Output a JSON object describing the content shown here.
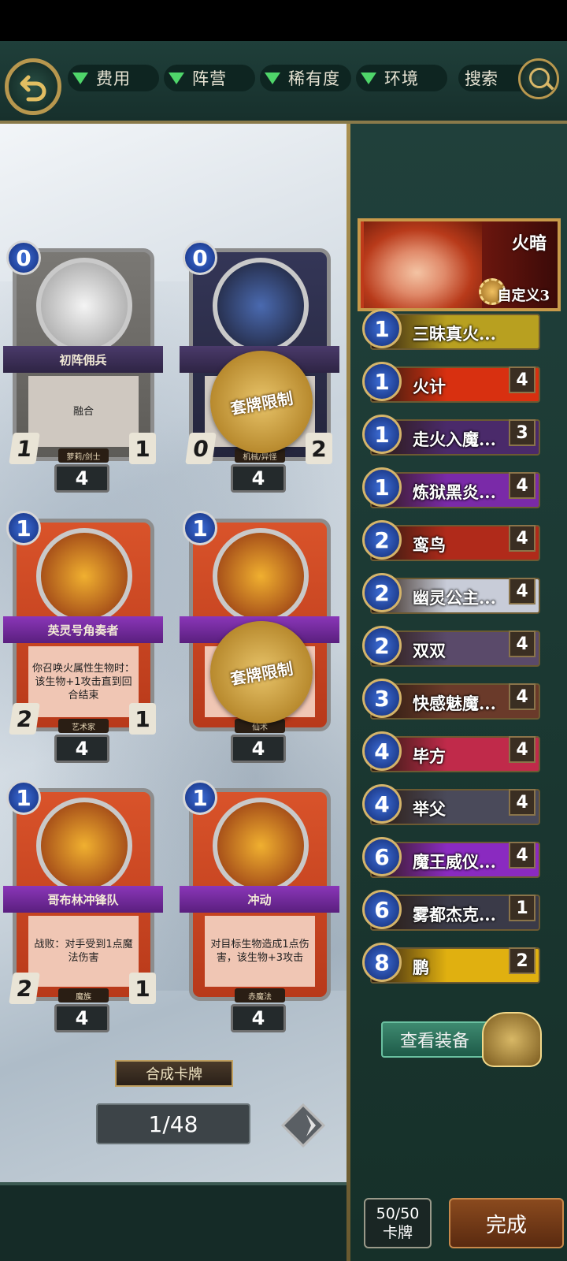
{
  "filters": {
    "cost": "费用",
    "faction": "阵营",
    "rarity": "稀有度",
    "environment": "环境",
    "search": "搜索"
  },
  "cards": [
    {
      "name": "初阵佣兵",
      "cost": "0",
      "atk": "1",
      "hp": "1",
      "desc": "融合",
      "tribe": "萝莉/剑士",
      "count": "4",
      "style": "neutral",
      "sealed": false
    },
    {
      "name": "",
      "cost": "0",
      "atk": "0",
      "hp": "2",
      "desc": "",
      "tribe": "机械/异怪",
      "count": "4",
      "style": "dark",
      "sealed": true
    },
    {
      "name": "英灵号角奏者",
      "cost": "1",
      "atk": "2",
      "hp": "1",
      "desc": "你召唤火属性生物时：该生物+1攻击直到回合结束",
      "tribe": "艺术家",
      "count": "4",
      "style": "fire",
      "sealed": false
    },
    {
      "name": "",
      "cost": "1",
      "atk": "",
      "hp": "",
      "desc": "",
      "tribe": "仙术",
      "count": "4",
      "style": "fire",
      "sealed": true
    },
    {
      "name": "哥布林冲锋队",
      "cost": "1",
      "atk": "2",
      "hp": "1",
      "desc": "战败：对手受到1点魔法伤害",
      "tribe": "魔族",
      "count": "4",
      "style": "fire",
      "sealed": false
    },
    {
      "name": "冲动",
      "cost": "1",
      "atk": "",
      "hp": "",
      "desc": "对目标生物造成1点伤害，该生物+3攻击",
      "tribe": "赤魔法",
      "count": "4",
      "style": "fire",
      "sealed": false
    }
  ],
  "seal_text": "套牌限制",
  "craft_label": "合成卡牌",
  "page_indicator": "1/48",
  "hero": {
    "name": "火暗",
    "deck_name": "自定义3"
  },
  "deck": [
    {
      "cost": "1",
      "name": "三昧真火...",
      "count": "",
      "color": "#b8a020"
    },
    {
      "cost": "1",
      "name": "火计",
      "count": "4",
      "color": "#d83010"
    },
    {
      "cost": "1",
      "name": "走火入魔...",
      "count": "3",
      "color": "#4a2a6a"
    },
    {
      "cost": "1",
      "name": "炼狱黑炎...",
      "count": "4",
      "color": "#7a2aa8"
    },
    {
      "cost": "2",
      "name": "鸾鸟",
      "count": "4",
      "color": "#b02a1a"
    },
    {
      "cost": "2",
      "name": "幽灵公主...",
      "count": "4",
      "color": "#c8ccd8"
    },
    {
      "cost": "2",
      "name": "双双",
      "count": "4",
      "color": "#5a4a6a"
    },
    {
      "cost": "3",
      "name": "快感魅魔...",
      "count": "4",
      "color": "#6a3a2a"
    },
    {
      "cost": "4",
      "name": "毕方",
      "count": "4",
      "color": "#c02a4a"
    },
    {
      "cost": "4",
      "name": "举父",
      "count": "4",
      "color": "#4a4a5a"
    },
    {
      "cost": "6",
      "name": "魔王威仪...",
      "count": "4",
      "color": "#8a2ac0"
    },
    {
      "cost": "6",
      "name": "雾都杰克...",
      "count": "1",
      "color": "#3a3a48"
    },
    {
      "cost": "8",
      "name": "鹏",
      "count": "2",
      "color": "#e0b010"
    }
  ],
  "equip_button": "查看装备",
  "deck_count": {
    "value": "50/50",
    "unit": "卡牌"
  },
  "done_button": "完成"
}
